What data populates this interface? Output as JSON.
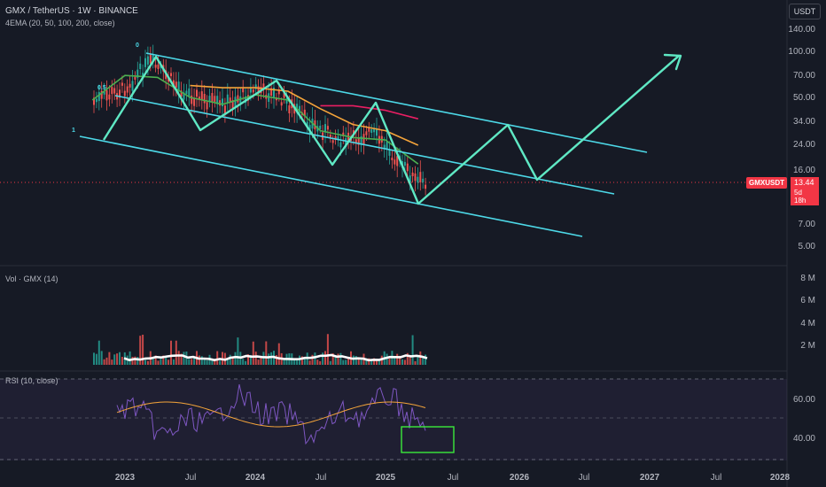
{
  "header": {
    "title": "GMX / TetherUS · 1W · BINANCE",
    "indicator": "4EMA (20, 50, 100, 200, close)"
  },
  "currency_button": "USDT",
  "price_badge": {
    "symbol": "GMXUSDT",
    "price": "13.44",
    "countdown": "5d 18h"
  },
  "fib_labels": {
    "level_0": "0",
    "level_05": "0.5",
    "level_1": "1"
  },
  "volume_pane": {
    "title": "Vol · GMX (14)"
  },
  "rsi_pane": {
    "title": "RSI (10, close)"
  },
  "price_axis": [
    "140.00",
    "100.00",
    "70.00",
    "50.00",
    "34.00",
    "24.00",
    "16.00",
    "7.00",
    "5.00"
  ],
  "volume_axis": [
    "8 M",
    "6 M",
    "4 M",
    "2 M"
  ],
  "rsi_axis": [
    "60.00",
    "40.00"
  ],
  "time_axis": [
    "2023",
    "Jul",
    "2024",
    "Jul",
    "2025",
    "Jul",
    "2026",
    "Jul",
    "2027",
    "Jul",
    "2028"
  ],
  "colors": {
    "background": "#161a25",
    "channel": "#4dd9e8",
    "zigzag": "#5fe8c4",
    "ema20": "#4caf50",
    "ema50": "#f4a43a",
    "ema100": "#e91e63",
    "rsi": "#7e57c2",
    "rsi_ma": "#f4a43a",
    "bull": "#26a69a",
    "bear": "#ef5350",
    "price_badge": "#f23645"
  },
  "chart_data": [
    {
      "type": "line",
      "pane": "price",
      "y_scale": "log",
      "series": [
        {
          "name": "EMA 20",
          "x": [
            "2022-10",
            "2023-01",
            "2023-04",
            "2023-07",
            "2023-10",
            "2024-01",
            "2024-04",
            "2024-07",
            "2024-10",
            "2025-01",
            "2025-04"
          ],
          "values": [
            48,
            70,
            68,
            50,
            45,
            52,
            48,
            30,
            27,
            26,
            18
          ]
        },
        {
          "name": "EMA 50",
          "x": [
            "2023-07",
            "2023-10",
            "2024-01",
            "2024-04",
            "2024-07",
            "2024-10",
            "2025-01",
            "2025-04"
          ],
          "values": [
            60,
            58,
            58,
            55,
            42,
            33,
            30,
            24
          ]
        },
        {
          "name": "EMA 100",
          "x": [
            "2024-07",
            "2024-10",
            "2025-01",
            "2025-04"
          ],
          "values": [
            44,
            44,
            41,
            36
          ]
        }
      ],
      "price_projection": {
        "last_price": 13.44
      }
    },
    {
      "type": "bar",
      "pane": "volume",
      "title": "Vol · GMX (14)",
      "ylim": [
        0,
        8000000
      ]
    },
    {
      "type": "line",
      "pane": "rsi",
      "title": "RSI (10, close)",
      "ylim": [
        20,
        80
      ]
    }
  ]
}
